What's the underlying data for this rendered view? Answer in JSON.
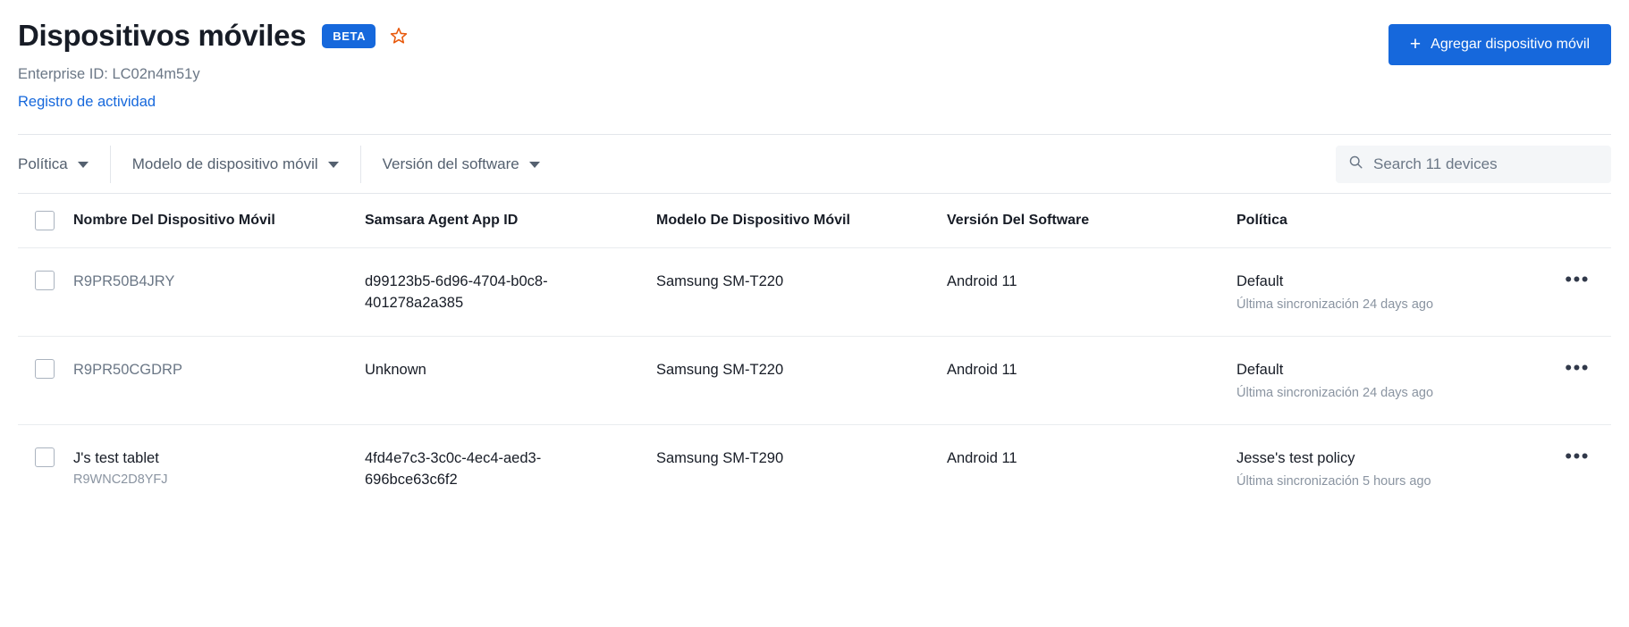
{
  "header": {
    "title": "Dispositivos móviles",
    "badge": "BETA",
    "star_icon": "star-outline-icon",
    "enterprise_id": "Enterprise ID: LC02n4m51y",
    "activity_link": "Registro de actividad",
    "add_button": {
      "plus": "+",
      "label": "Agregar dispositivo móvil"
    },
    "accent_color": "#1668dc",
    "star_color": "#e8590c"
  },
  "filters": [
    {
      "label": "Política",
      "icon": "chevron-down-icon"
    },
    {
      "label": "Modelo de dispositivo móvil",
      "icon": "chevron-down-icon"
    },
    {
      "label": "Versión del software",
      "icon": "chevron-down-icon"
    }
  ],
  "search": {
    "icon": "search-icon",
    "placeholder": "Search 11 devices",
    "value": ""
  },
  "table": {
    "columns": [
      "Nombre Del Dispositivo Móvil",
      "Samsara Agent App ID",
      "Modelo De Dispositivo Móvil",
      "Versión Del Software",
      "Política"
    ],
    "rows": [
      {
        "name": "R9PR50B4JRY",
        "subname": "",
        "app_id": "d99123b5-6d96-4704-b0c8-401278a2a385",
        "model": "Samsung SM-T220",
        "software": "Android 11",
        "policy": "Default",
        "last_sync": "Última sincronización 24 days ago",
        "menu_icon": "overflow-menu-icon"
      },
      {
        "name": "R9PR50CGDRP",
        "subname": "",
        "app_id": "Unknown",
        "model": "Samsung SM-T220",
        "software": "Android 11",
        "policy": "Default",
        "last_sync": "Última sincronización 24 days ago",
        "menu_icon": "overflow-menu-icon"
      },
      {
        "name": "J's test tablet",
        "subname": "R9WNC2D8YFJ",
        "app_id": "4fd4e7c3-3c0c-4ec4-aed3-696bce63c6f2",
        "model": "Samsung SM-T290",
        "software": "Android 11",
        "policy": "Jesse's test policy",
        "last_sync": "Última sincronización 5 hours ago",
        "menu_icon": "overflow-menu-icon"
      }
    ]
  }
}
